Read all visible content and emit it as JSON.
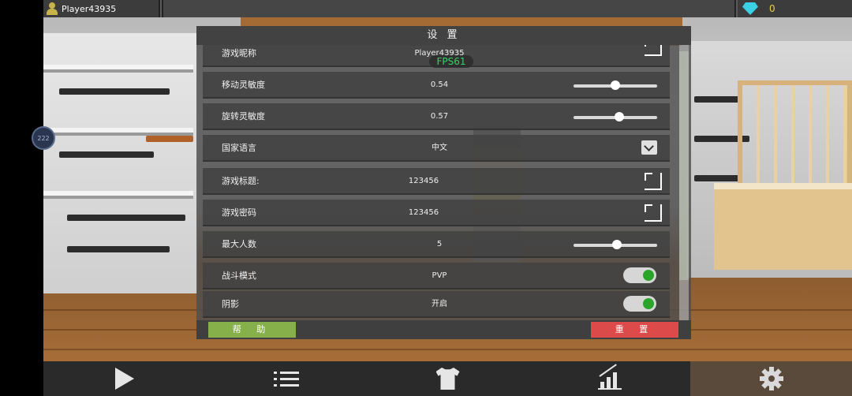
{
  "topbar": {
    "player_name": "Player43935",
    "gems": "0"
  },
  "ping_badge": "222",
  "fps_label": "FPS61",
  "settings": {
    "title": "设 置",
    "rows": [
      {
        "label": "游戏昵称",
        "value": "Player43935",
        "control": "edit"
      },
      {
        "label": "移动灵敏度",
        "value": "0.54",
        "control": "slider",
        "level": 0.5
      },
      {
        "label": "旋转灵敏度",
        "value": "0.57",
        "control": "slider",
        "level": 0.55
      },
      {
        "label": "国家语言",
        "value": "中文",
        "control": "dropdown"
      },
      {
        "label": "游戏标题:",
        "value": "123456",
        "control": "edit"
      },
      {
        "label": "游戏密码",
        "value": "123456",
        "control": "edit"
      },
      {
        "label": "最大人数",
        "value": "5",
        "control": "slider",
        "level": 0.52
      },
      {
        "label": "战斗模式",
        "value": "PVP",
        "control": "toggle",
        "on": true
      },
      {
        "label": "阴影",
        "value": "开启",
        "control": "toggle",
        "on": true
      }
    ],
    "help_label": "帮 助",
    "reset_label": "重 置"
  },
  "bottom_nav": [
    {
      "name": "nav-play",
      "icon": "play-icon",
      "active": false
    },
    {
      "name": "nav-list",
      "icon": "list-icon",
      "active": false
    },
    {
      "name": "nav-skins",
      "icon": "shirt-icon",
      "active": false
    },
    {
      "name": "nav-stats",
      "icon": "chart-icon",
      "active": false
    },
    {
      "name": "nav-settings",
      "icon": "gear-icon",
      "active": true
    }
  ],
  "colors": {
    "help_button": "#86b04a",
    "reset_button": "#dc4a4a",
    "toggle_on": "#2aa52a",
    "fps_text": "#36d36a",
    "gem": "#3ad0e6",
    "gem_count": "#e9d04b"
  }
}
